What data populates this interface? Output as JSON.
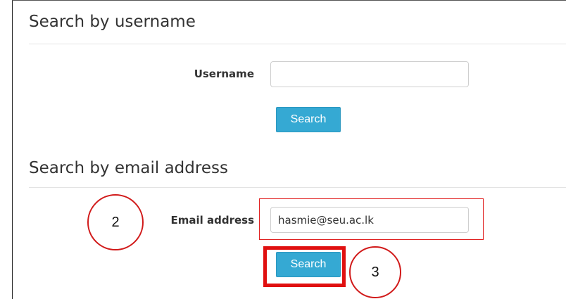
{
  "username_section": {
    "heading": "Search by username",
    "field_label": "Username",
    "field_value": "",
    "button_label": "Search"
  },
  "email_section": {
    "heading": "Search by email address",
    "field_label": "Email address",
    "field_value": "hasmie@seu.ac.lk",
    "button_label": "Search"
  },
  "annotations": {
    "step_email": "2",
    "step_search": "3",
    "highlight_color": "#e01010"
  },
  "theme": {
    "button_color": "#35a9d3"
  }
}
